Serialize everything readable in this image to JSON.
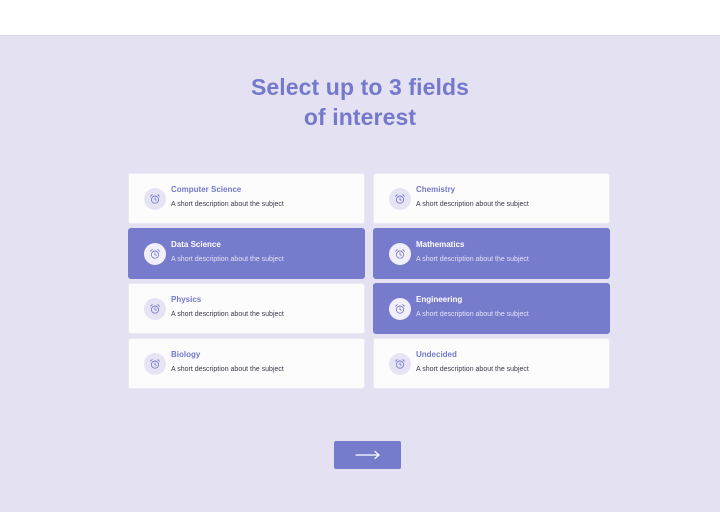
{
  "heading": {
    "line1": "Select up to 3 fields",
    "line2": "of interest"
  },
  "fields": [
    {
      "title": "Computer Science",
      "description": "A short description about the subject",
      "selected": false,
      "icon": "alarm-clock-icon"
    },
    {
      "title": "Chemistry",
      "description": "A short description about the subject",
      "selected": false,
      "icon": "alarm-clock-icon"
    },
    {
      "title": "Data Science",
      "description": "A short description about the subject",
      "selected": true,
      "icon": "alarm-clock-icon"
    },
    {
      "title": "Mathematics",
      "description": "A short description about the subject",
      "selected": true,
      "icon": "alarm-clock-icon"
    },
    {
      "title": "Physics",
      "description": "A short description about the subject",
      "selected": false,
      "icon": "alarm-clock-icon"
    },
    {
      "title": "Engineering",
      "description": "A short description about the subject",
      "selected": true,
      "icon": "alarm-clock-icon"
    },
    {
      "title": "Biology",
      "description": "A short description about the subject",
      "selected": false,
      "icon": "alarm-clock-icon"
    },
    {
      "title": "Undecided",
      "description": "A short description about the subject",
      "selected": false,
      "icon": "alarm-clock-icon"
    }
  ],
  "next_button": {
    "icon": "arrow-right-icon"
  },
  "colors": {
    "accent": "#777bcb",
    "background": "#e4e1f3",
    "card": "#fcfcfd"
  }
}
